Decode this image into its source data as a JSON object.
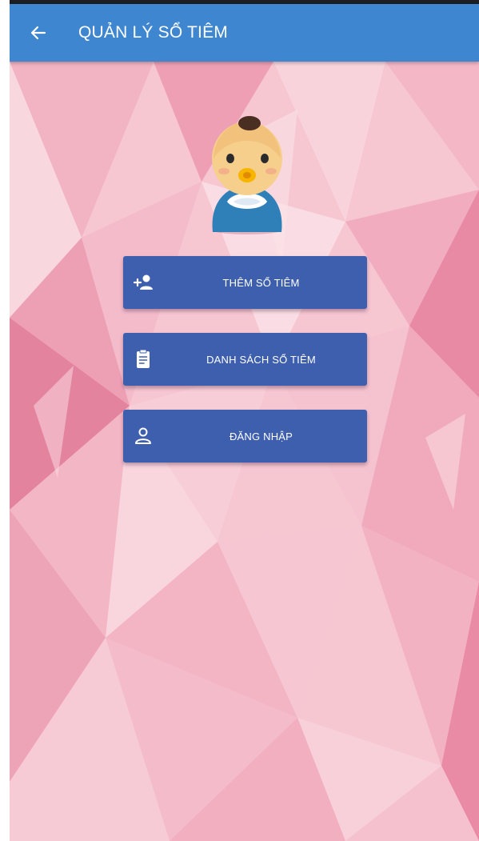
{
  "app_bar": {
    "title": "QUẢN LÝ SỔ TIÊM",
    "back_icon": "arrow-left-icon",
    "background": "#3f86d0"
  },
  "mascot": {
    "icon": "baby-icon"
  },
  "menu": {
    "button_color": "#3d5fad",
    "items": [
      {
        "label": "THÊM SỔ TIÊM",
        "icon": "add-person-icon"
      },
      {
        "label": "DANH SÁCH SỔ TIÊM",
        "icon": "clipboard-icon"
      },
      {
        "label": "ĐĂNG NHẬP",
        "icon": "person-outline-icon"
      }
    ]
  },
  "background": {
    "base_color": "#f6c6d1",
    "accent_color": "#e8809c"
  }
}
